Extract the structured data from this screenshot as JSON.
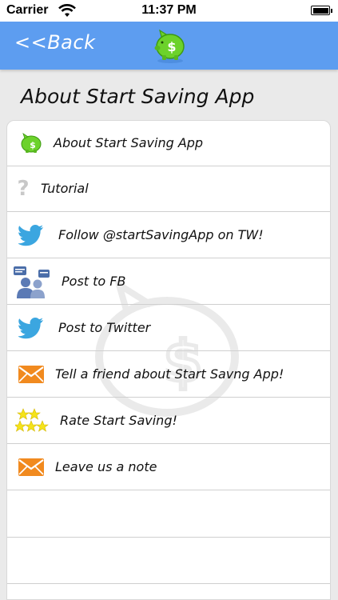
{
  "status_bar": {
    "carrier": "Carrier",
    "time": "11:37 PM"
  },
  "nav": {
    "back_label": "<<Back",
    "logo_icon": "piggy-bank-dollar-icon",
    "bar_color": "#5d9df0"
  },
  "page": {
    "title": "About Start Saving App"
  },
  "menu": {
    "items": [
      {
        "label": "About Start Saving App",
        "icon": "piggy-bank-icon"
      },
      {
        "label": "Tutorial",
        "icon": "question-mark-icon"
      },
      {
        "label": "Follow @startSavingApp on TW!",
        "icon": "twitter-bird-icon"
      },
      {
        "label": "Post to FB",
        "icon": "people-chat-icon"
      },
      {
        "label": "Post to Twitter",
        "icon": "twitter-bird-icon"
      },
      {
        "label": "Tell a friend about Start Savng App!",
        "icon": "envelope-icon"
      },
      {
        "label": "Rate Start Saving!",
        "icon": "stars-icon"
      },
      {
        "label": "Leave us a note",
        "icon": "envelope-icon"
      }
    ]
  },
  "colors": {
    "accent_green": "#6cd22b",
    "twitter_blue": "#3ba6e0",
    "envelope_orange": "#f18a1f",
    "star_yellow": "#f5e31a"
  }
}
